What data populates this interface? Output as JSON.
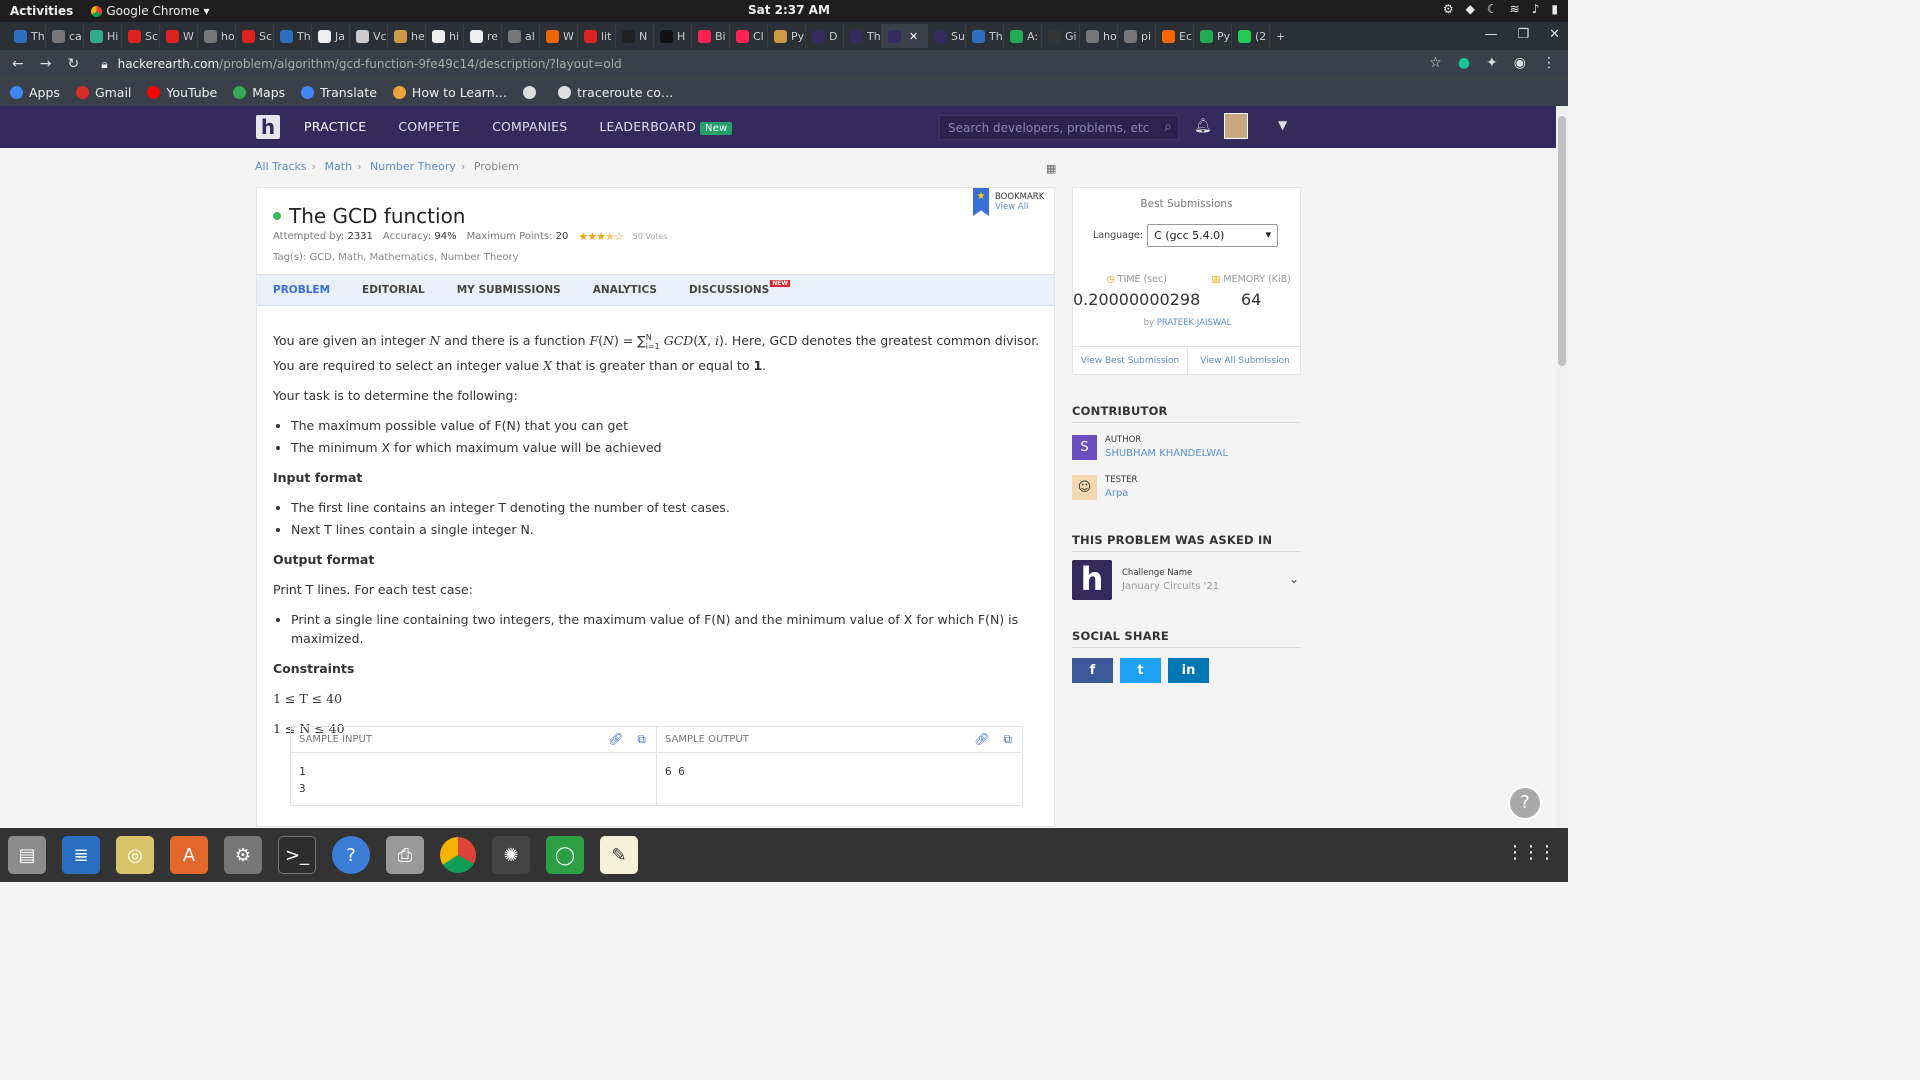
{
  "system": {
    "activities": "Activities",
    "app": "Google Chrome",
    "clock": "Sat  2:37 AM"
  },
  "tabs": [
    {
      "label": "Th",
      "color": "#2d6ec0"
    },
    {
      "label": "ca",
      "color": "#777"
    },
    {
      "label": "Hi",
      "color": "#3a8"
    },
    {
      "label": "Sc",
      "color": "#d22"
    },
    {
      "label": "W",
      "color": "#d22"
    },
    {
      "label": "ho",
      "color": "#777"
    },
    {
      "label": "Sc",
      "color": "#d22"
    },
    {
      "label": "Th",
      "color": "#2d6ec0"
    },
    {
      "label": "Ja",
      "color": "#eee"
    },
    {
      "label": "Vc",
      "color": "#ccc"
    },
    {
      "label": "he",
      "color": "#c94"
    },
    {
      "label": "hi",
      "color": "#eee"
    },
    {
      "label": "re",
      "color": "#eee"
    },
    {
      "label": "al",
      "color": "#777"
    },
    {
      "label": "W",
      "color": "#e60"
    },
    {
      "label": "lit",
      "color": "#d22"
    },
    {
      "label": "N",
      "color": "#222"
    },
    {
      "label": "H",
      "color": "#111"
    },
    {
      "label": "Bi",
      "color": "#f25"
    },
    {
      "label": "Cl",
      "color": "#f25"
    },
    {
      "label": "Py",
      "color": "#c94"
    },
    {
      "label": "D",
      "color": "#342a5c"
    },
    {
      "label": "Th",
      "color": "#342a5c"
    },
    {
      "label": "",
      "color": "#342a5c",
      "active": true
    },
    {
      "label": "Su",
      "color": "#342a5c"
    },
    {
      "label": "Th",
      "color": "#2d6ec0"
    },
    {
      "label": "A:",
      "color": "#2a5"
    },
    {
      "label": "Gi",
      "color": "#333"
    },
    {
      "label": "ho",
      "color": "#777"
    },
    {
      "label": "pi",
      "color": "#777"
    },
    {
      "label": "Ec",
      "color": "#f60"
    },
    {
      "label": "Py",
      "color": "#2a5"
    },
    {
      "label": "(2",
      "color": "#2c5"
    }
  ],
  "address": {
    "host": "hackerearth.com",
    "path": "/problem/algorithm/gcd-function-9fe49c14/description/?layout=old"
  },
  "bookmarks": [
    "Apps",
    "Gmail",
    "YouTube",
    "Maps",
    "Translate",
    "How to Learn…",
    "",
    "traceroute co…"
  ],
  "nav": {
    "logo": "h",
    "items": [
      "PRACTICE",
      "COMPETE",
      "COMPANIES",
      "LEADERBOARD"
    ],
    "new_badge": "New",
    "search_placeholder": "Search developers, problems, etc"
  },
  "breadcrumbs": [
    "All Tracks",
    "Math",
    "Number Theory",
    "Problem"
  ],
  "problem": {
    "title": "The GCD function",
    "attempted_label": "Attempted by:",
    "attempted": "2331",
    "accuracy_label": "Accuracy:",
    "accuracy": "94%",
    "points_label": "Maximum Points:",
    "points": "20",
    "rating_stars": 3.5,
    "votes": "50 Votes",
    "tags": "Tag(s): GCD, Math, Mathematics, Number Theory",
    "bookmark": "BOOKMARK",
    "view_all": "View All"
  },
  "problem_tabs": [
    "PROBLEM",
    "EDITORIAL",
    "MY SUBMISSIONS",
    "ANALYTICS",
    "DISCUSSIONS"
  ],
  "new_tag": "NEW",
  "statement": {
    "intro_a": "You are given an integer ",
    "intro_b": " and there is a function ",
    "intro_c": ". Here, GCD denotes the greatest common divisor. You are required to select an integer value ",
    "intro_d": " that is greater than or equal to ",
    "one": "1",
    "task": "Your task is to determine the following:",
    "task_items": [
      "The maximum possible value of F(N) that you can get",
      "The minimum X for which maximum value will be achieved"
    ],
    "input_h": "Input format",
    "input_items": [
      "The first line contains an integer T denoting the number of test cases.",
      "Next T lines contain a single integer N."
    ],
    "output_h": "Output format",
    "output_p": "Print T lines. For each test case:",
    "output_items": [
      "Print a single line containing two integers, the maximum value of F(N) and the minimum value of X for which F(N) is maximized."
    ],
    "constraints_h": "Constraints",
    "c1": "1 ≤ T ≤ 40",
    "c2": "1 ≤ N ≤ 40"
  },
  "sample": {
    "input_label": "SAMPLE INPUT",
    "input": "1\n3",
    "output_label": "SAMPLE OUTPUT",
    "output": "6 6"
  },
  "best": {
    "heading": "Best Submissions",
    "language_label": "Language:",
    "language": "C (gcc 5.4.0)",
    "time_label": "TIME (sec)",
    "time": "0.20000000298",
    "memory_label": "MEMORY (KiB)",
    "memory": "64",
    "by": "by",
    "by_name": "PRATEEK JAISWAL",
    "view_best": "View Best Submission",
    "view_all": "View All Submission"
  },
  "contributor": {
    "heading": "CONTRIBUTOR",
    "author_label": "AUTHOR",
    "author": "SHUBHAM KHANDELWAL",
    "author_initial": "S",
    "tester_label": "TESTER",
    "tester": "Arpa"
  },
  "asked": {
    "heading": "THIS PROBLEM WAS ASKED IN",
    "label": "Challenge Name",
    "name": "January Circuits '21"
  },
  "social": {
    "heading": "SOCIAL SHARE",
    "buttons": [
      "f",
      "t",
      "in"
    ]
  }
}
